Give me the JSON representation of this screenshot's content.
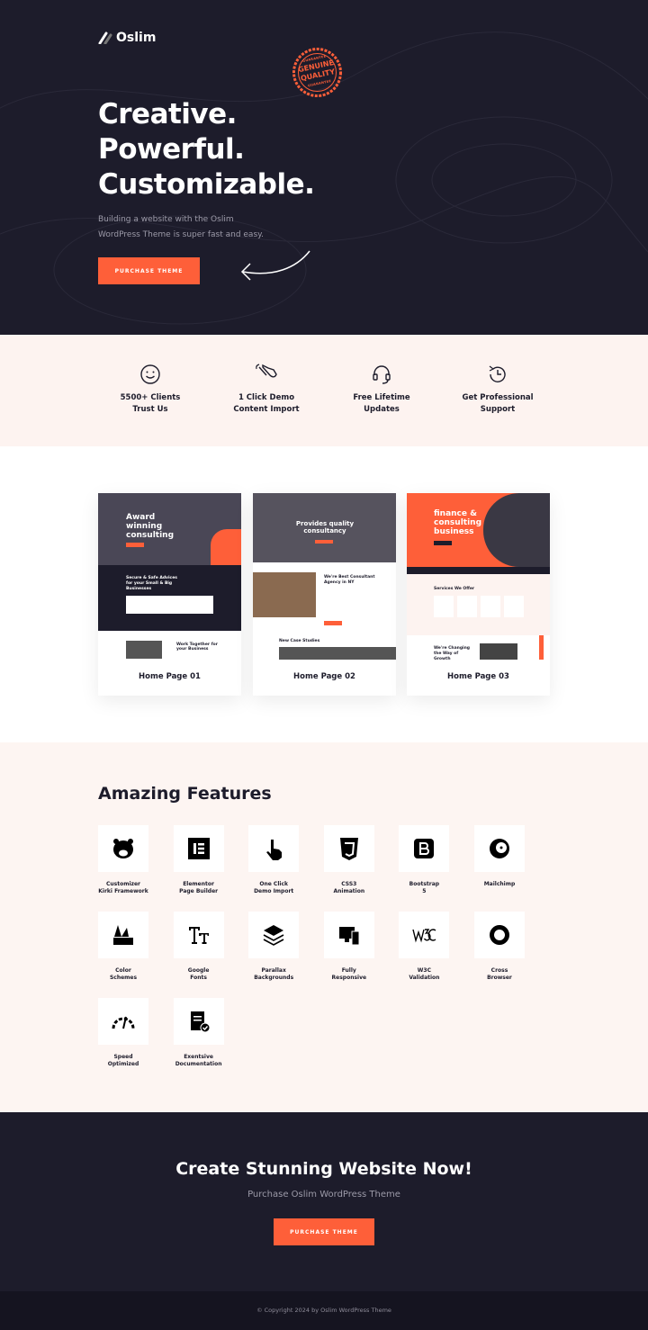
{
  "colors": {
    "accent": "#fe5f39",
    "dark": "#1d1c2b",
    "cream": "#fdf3f0"
  },
  "hero": {
    "logo": "Oslim",
    "badge": [
      "GUARANTEE",
      "GENUINE",
      "QUALITY",
      "GUARANTEE"
    ],
    "title": [
      "Creative.",
      "Powerful.",
      "Customizable."
    ],
    "subtitle": "Building a website with the Oslim WordPress Theme is super fast and easy.",
    "button": "PURCHASE THEME"
  },
  "highlights": [
    {
      "icon": "smile-icon",
      "line1": "5500+ Clients",
      "line2": "Trust Us"
    },
    {
      "icon": "hand-pointer-icon",
      "line1": "1 Click Demo",
      "line2": "Content Import"
    },
    {
      "icon": "headset-icon",
      "line1": "Free Lifetime",
      "line2": "Updates"
    },
    {
      "icon": "clock-support-icon",
      "line1": "Get Professional",
      "line2": "Support"
    }
  ],
  "demos": [
    {
      "label": "Home Page 01",
      "hero": "Award winning consulting",
      "sec": "Secure & Safe Advices for your Small & Big Businesses",
      "sec2": "Work Together for your Business"
    },
    {
      "label": "Home Page 02",
      "hero": "Provides quality consultancy",
      "sec": "We're Best Consultant Agency in NY",
      "sec2": "New Case Studies"
    },
    {
      "label": "Home Page 03",
      "hero": "finance & consulting business",
      "sec": "Services We Offer",
      "sec2": "We're Changing the Way of Growth"
    }
  ],
  "features": {
    "title": "Amazing Features",
    "items": [
      {
        "icon": "pig-icon",
        "l1": "Customizer",
        "l2": "Kirki Framework"
      },
      {
        "icon": "elementor-icon",
        "l1": "Elementor",
        "l2": "Page Builder"
      },
      {
        "icon": "hand-click-icon",
        "l1": "One Click",
        "l2": "Demo Import"
      },
      {
        "icon": "css3-icon",
        "l1": "CSS3",
        "l2": "Animation"
      },
      {
        "icon": "bootstrap-icon",
        "l1": "Bootstrap",
        "l2": "5"
      },
      {
        "icon": "mailchimp-icon",
        "l1": "Mailchimp",
        "l2": ""
      },
      {
        "icon": "palette-icon",
        "l1": "Color",
        "l2": "Schemes"
      },
      {
        "icon": "font-icon",
        "l1": "Google",
        "l2": "Fonts"
      },
      {
        "icon": "layers-icon",
        "l1": "Parallax",
        "l2": "Backgrounds"
      },
      {
        "icon": "devices-icon",
        "l1": "Fully",
        "l2": "Responsive"
      },
      {
        "icon": "w3c-icon",
        "l1": "W3C",
        "l2": "Validation"
      },
      {
        "icon": "cross-browser-icon",
        "l1": "Cross",
        "l2": "Browser"
      },
      {
        "icon": "speedometer-icon",
        "l1": "Speed",
        "l2": "Optimized"
      },
      {
        "icon": "documentation-icon",
        "l1": "Exentsive",
        "l2": "Documentation"
      }
    ]
  },
  "cta": {
    "title": "Create Stunning Website Now!",
    "subtitle": "Purchase Oslim WordPress Theme",
    "button": "PURCHASE THEME"
  },
  "footer": {
    "copyright": "© Copyright 2024 by Oslim WordPress Theme"
  }
}
